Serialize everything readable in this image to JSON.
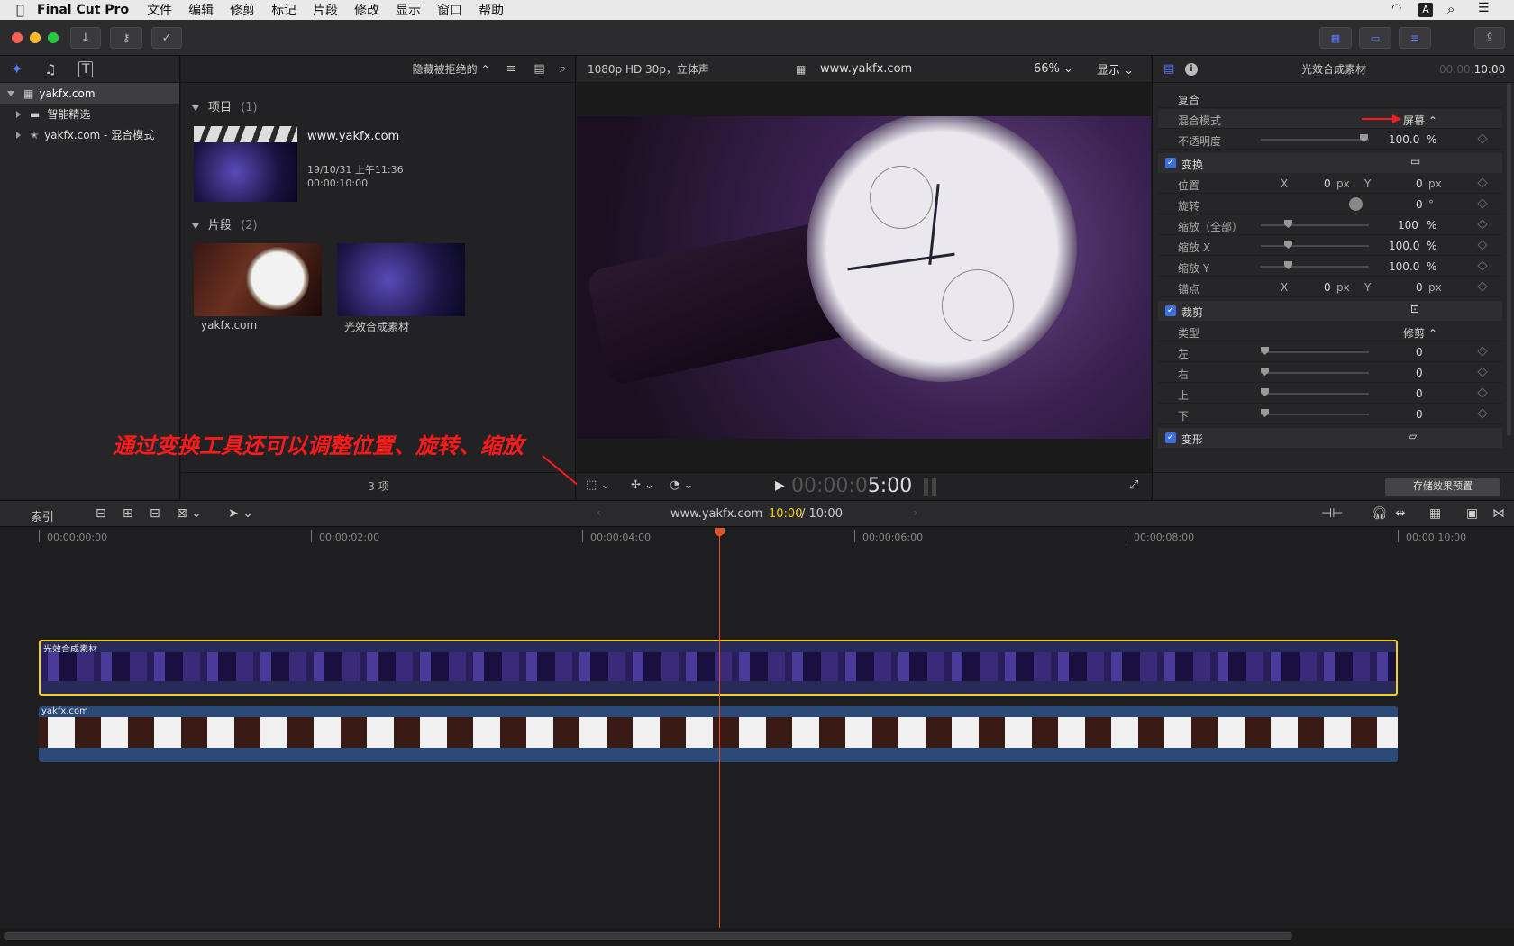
{
  "menubar": {
    "apple": "",
    "app": "Final Cut Pro",
    "items": [
      "文件",
      "编辑",
      "修剪",
      "标记",
      "片段",
      "修改",
      "显示",
      "窗口",
      "帮助"
    ]
  },
  "library": {
    "items": [
      {
        "label": "yakfx.com"
      },
      {
        "label": "智能精选"
      },
      {
        "label": "yakfx.com - 混合模式"
      }
    ]
  },
  "browser": {
    "filter": "隐藏被拒绝的",
    "projects_title": "项目",
    "projects_count": "(1)",
    "project": {
      "name": "www.yakfx.com",
      "date": "19/10/31 上午11:36",
      "duration": "00:00:10:00"
    },
    "clips_title": "片段",
    "clips_count": "(2)",
    "clips": [
      {
        "name": "yakfx.com"
      },
      {
        "name": "光效合成素材"
      }
    ],
    "footer": "3 项"
  },
  "viewer": {
    "format": "1080p HD 30p，立体声",
    "title": "www.yakfx.com",
    "zoom": "66%",
    "display": "显示",
    "timecode_dim": "00:00:0",
    "timecode_bright": "5:00"
  },
  "annotation": {
    "text": "通过变换工具还可以调整位置、旋转、缩放"
  },
  "inspector": {
    "clip_name": "光效合成素材",
    "timecode_dim": "00:00:",
    "timecode_bright": "10:00",
    "composite": "复合",
    "blend_mode_label": "混合模式",
    "blend_mode_value": "屏幕",
    "opacity_label": "不透明度",
    "opacity_value": "100.0",
    "opacity_unit": "%",
    "opacity_level": 1.0,
    "transform": "变换",
    "position_label": "位置",
    "x": "X",
    "y": "Y",
    "pos_x": "0",
    "pos_y": "0",
    "px": "px",
    "rotation_label": "旋转",
    "rotation_value": "0",
    "deg": "°",
    "scale_all_label": "缩放（全部）",
    "scale_all_value": "100",
    "scale_x_label": "缩放 X",
    "scale_x_value": "100.0",
    "scale_y_label": "缩放 Y",
    "scale_y_value": "100.0",
    "pct": "%",
    "anchor_label": "锚点",
    "anchor_x": "0",
    "anchor_y": "0",
    "crop": "裁剪",
    "type_label": "类型",
    "type_value": "修剪",
    "left_label": "左",
    "right_label": "右",
    "top_label": "上",
    "bottom_label": "下",
    "crop_value": "0",
    "distort": "变形",
    "save_preset": "存储效果预置"
  },
  "timeline_bar": {
    "index": "索引",
    "project": "www.yakfx.com",
    "current": "10:00",
    "total": "/ 10:00"
  },
  "ruler": [
    "00:00:00:00",
    "00:00:02:00",
    "00:00:04:00",
    "00:00:06:00",
    "00:00:08:00",
    "00:00:10:00"
  ],
  "tracks": {
    "upper": "光效合成素材",
    "lower": "yakfx.com"
  },
  "colors": {
    "accent": "#3d6fe0",
    "playhead": "#e0532a",
    "selection": "#f2d21b",
    "annotation": "#ff1a1a"
  }
}
